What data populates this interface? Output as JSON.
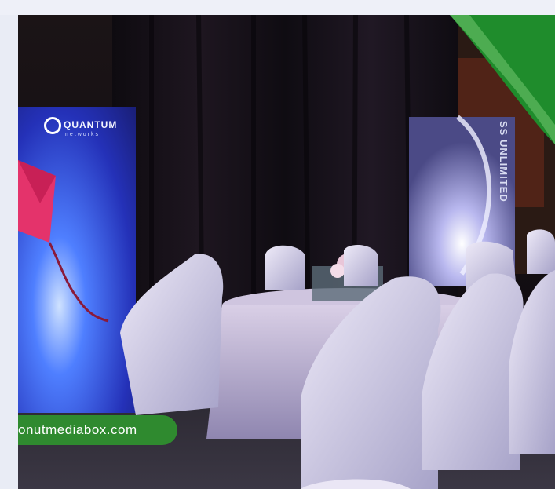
{
  "scene": {
    "banner_left_logo": "QUANTUM",
    "banner_left_logo_sub": "networks",
    "banner_right_text": "SS UNLIMITED",
    "watermark": "onutmediabox.com"
  },
  "colors": {
    "watermark_bg": "#2f8a2f",
    "corner_green": "#1f8c2c",
    "banner_blue": "#2b3fd0"
  }
}
